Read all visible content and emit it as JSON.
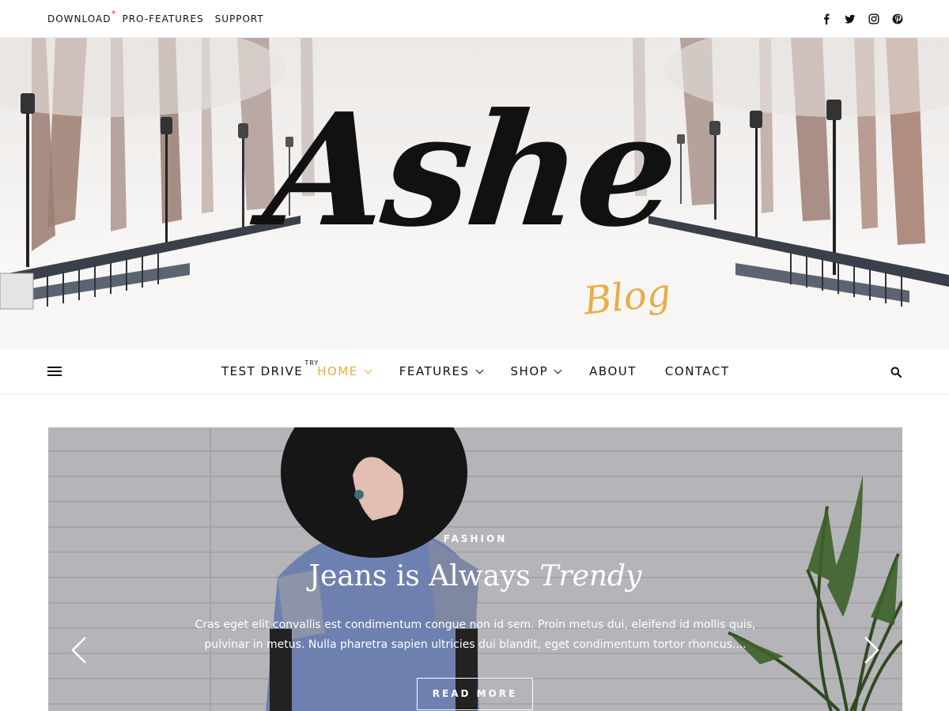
{
  "topbar": {
    "links": [
      {
        "label": "DOWNLOAD",
        "marker": "*"
      },
      {
        "label": "PRO-FEATURES"
      },
      {
        "label": "SUPPORT"
      }
    ],
    "social_icons": [
      "facebook-icon",
      "twitter-icon",
      "instagram-icon",
      "pinterest-icon"
    ]
  },
  "header": {
    "logo_text": "Ashe",
    "logo_subtext": "Blog",
    "accent_color": "#e9ad45"
  },
  "nav": {
    "items": [
      {
        "label": "TEST DRIVE",
        "sup": "TRY",
        "dropdown": false,
        "active": false
      },
      {
        "label": "HOME",
        "dropdown": true,
        "active": true
      },
      {
        "label": "FEATURES",
        "dropdown": true,
        "active": false
      },
      {
        "label": "SHOP",
        "dropdown": true,
        "active": false
      },
      {
        "label": "ABOUT",
        "dropdown": false,
        "active": false
      },
      {
        "label": "CONTACT",
        "dropdown": false,
        "active": false
      }
    ]
  },
  "slider": {
    "category": "FASHION",
    "title_plain": "Jeans is Always",
    "title_italic": "Trendy",
    "excerpt": "Cras eget elit convallis est condimentum congue non id sem. Proin metus dui, eleifend id mollis quis, pulvinar in metus. Nulla pharetra sapien ultricies dui blandit, eget condimentum tortor rhoncus....",
    "button_label": "READ MORE"
  }
}
